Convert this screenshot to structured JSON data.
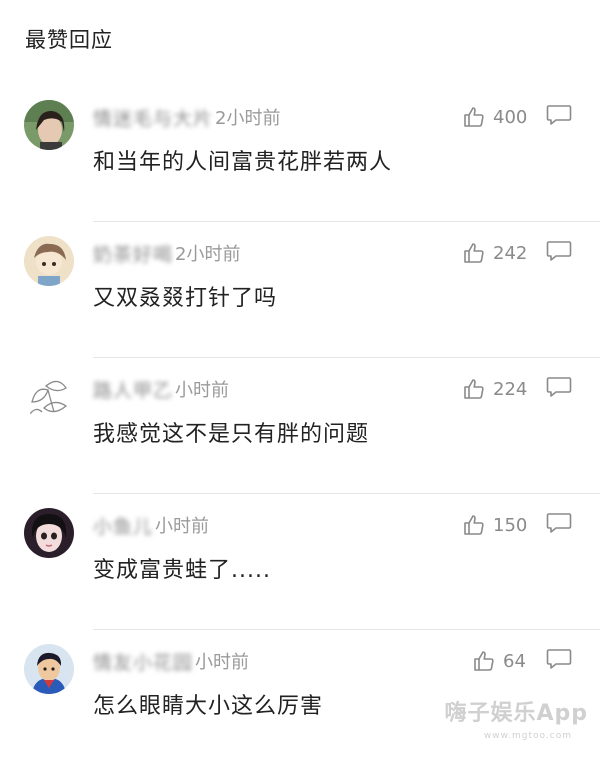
{
  "section": {
    "title": "最赞回应"
  },
  "comments": [
    {
      "username": "情迷毛与大片",
      "time": "2小时前",
      "text": "和当年的人间富贵花胖若两人",
      "likes": "400"
    },
    {
      "username": "奶茶好喝",
      "time": "2小时前",
      "text": "又双叒叕打针了吗",
      "likes": "242"
    },
    {
      "username": "路人甲乙",
      "time": "小时前",
      "text": "我感觉这不是只有胖的问题",
      "likes": "224"
    },
    {
      "username": "小鱼儿",
      "time": "小时前",
      "text": "变成富贵蛙了.....",
      "likes": "150"
    },
    {
      "username": "情友小花园",
      "time": "小时前",
      "text": "怎么眼睛大小这么厉害",
      "likes": "64"
    }
  ],
  "icons": {
    "like": "thumbs-up-icon",
    "reply": "comment-bubble-icon"
  },
  "watermark": {
    "brand": "嗨子娱乐App",
    "url": "www.mgtoo.com"
  }
}
